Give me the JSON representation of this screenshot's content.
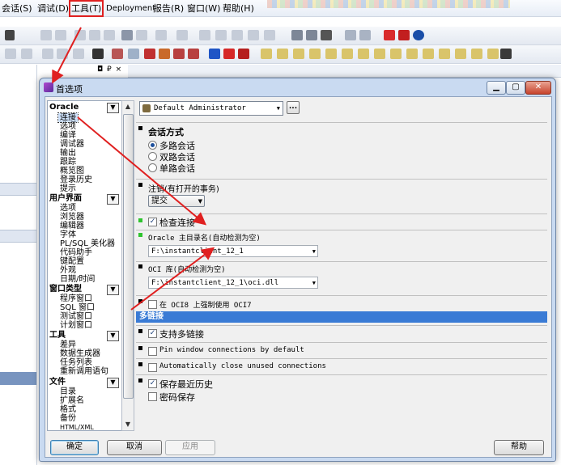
{
  "menubar": {
    "items": [
      "会话(S)",
      "调试(D)",
      "工具(T)",
      "Deployment",
      "报告(R)",
      "窗口(W)",
      "帮助(H)"
    ]
  },
  "dock": {
    "controls": "◘ ₽ ×"
  },
  "dialog": {
    "title": "首选项",
    "window_buttons": {
      "minimize": "▁",
      "maximize": "▢",
      "close": "✕"
    }
  },
  "tree": {
    "groups": [
      {
        "title": "Oracle",
        "items": [
          "连接",
          "选项",
          "编译",
          "调试器",
          "输出",
          "跟踪",
          "概览图",
          "登录历史",
          "提示"
        ]
      },
      {
        "title": "用户界面",
        "items": [
          "选项",
          "浏览器",
          "编辑器",
          "字体",
          "PL/SQL 美化器",
          "代码助手",
          "键配置",
          "外观",
          "日期/时间"
        ]
      },
      {
        "title": "窗口类型",
        "items": [
          "程序窗口",
          "SQL 窗口",
          "测试窗口",
          "计划窗口"
        ]
      },
      {
        "title": "工具",
        "items": [
          "差异",
          "数据生成器",
          "任务列表",
          "重新调用语句"
        ]
      },
      {
        "title": "文件",
        "items": [
          "目录",
          "扩展名",
          "格式",
          "备份",
          "HTML/XML"
        ]
      }
    ],
    "selected": "连接"
  },
  "panel": {
    "user_combo": "Default Administrator",
    "ellipsis": "...",
    "session_mode": {
      "title": "会话方式",
      "options": [
        "多路会话",
        "双路会话",
        "单路会话"
      ],
      "selected_index": 0
    },
    "commit": {
      "label": "注销(有打开的事务)",
      "value": "提交"
    },
    "check_connection": {
      "label": "检查连接",
      "checked": true
    },
    "oracle_home": {
      "label": "Oracle 主目录名(自动检测为空)",
      "value": "F:\\instantclient_12_1"
    },
    "oci_lib": {
      "label": "OCI 库(自动检测为空)",
      "value": "F:\\instantclient_12_1\\oci.dll"
    },
    "force_oci7": {
      "label": "在 OCI8 上强制使用 OCI7",
      "checked": false
    },
    "multi_header": "多链接",
    "support_multi": {
      "label": "支持多链接",
      "checked": true
    },
    "pin_window": {
      "label": "Pin window connections by default",
      "checked": false
    },
    "auto_close": {
      "label": "Automatically close unused connections",
      "checked": false
    },
    "save_history": {
      "label": "保存最近历史",
      "checked": true
    },
    "save_password": {
      "label": "密码保存",
      "checked": false
    }
  },
  "buttons": {
    "ok": "确定",
    "cancel": "取消",
    "apply": "应用",
    "help": "帮助"
  },
  "colors": {
    "annotation": "#e02020",
    "accent": "#3a7bd5",
    "green_marker": "#2ec42e"
  }
}
